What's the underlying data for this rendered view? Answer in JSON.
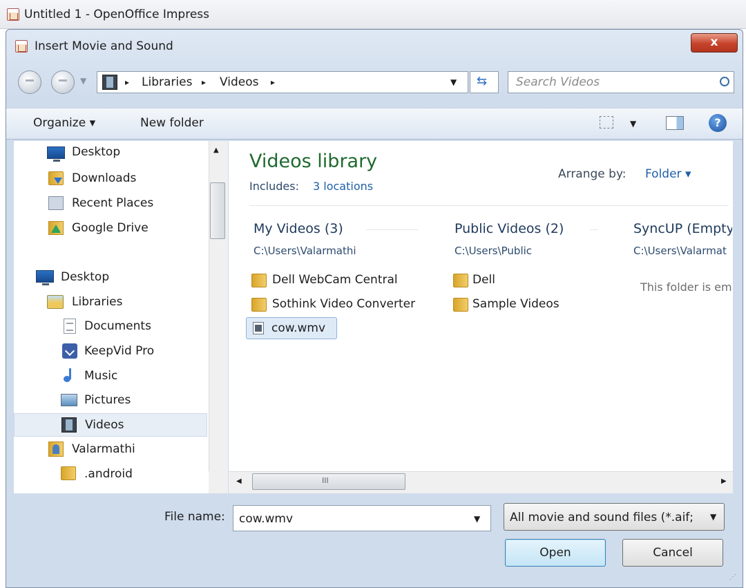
{
  "app": {
    "title": "Untitled 1 - OpenOffice Impress"
  },
  "dialog": {
    "title": "Insert Movie and Sound",
    "close": "x"
  },
  "address": {
    "crumbs": [
      "Libraries",
      "Videos"
    ],
    "separator": "▸"
  },
  "search": {
    "placeholder": "Search Videos"
  },
  "toolbar": {
    "organize": "Organize ▾",
    "new_folder": "New folder"
  },
  "nav": {
    "items": [
      {
        "label": "Desktop",
        "icon": "desktop-icon"
      },
      {
        "label": "Downloads",
        "icon": "downloads-icon"
      },
      {
        "label": "Recent Places",
        "icon": "recent-places-icon"
      },
      {
        "label": "Google Drive",
        "icon": "google-drive-icon"
      },
      {
        "label": "Desktop",
        "icon": "desktop-icon"
      },
      {
        "label": "Libraries",
        "icon": "libraries-icon"
      },
      {
        "label": "Documents",
        "icon": "documents-icon"
      },
      {
        "label": "KeepVid Pro",
        "icon": "keepvid-icon"
      },
      {
        "label": "Music",
        "icon": "music-icon"
      },
      {
        "label": "Pictures",
        "icon": "pictures-icon"
      },
      {
        "label": "Videos",
        "icon": "videos-icon",
        "selected": true
      },
      {
        "label": "Valarmathi",
        "icon": "user-folder-icon"
      },
      {
        "label": ".android",
        "icon": "folder-icon"
      }
    ]
  },
  "library": {
    "title": "Videos library",
    "includes_label": "Includes:",
    "includes_link": "3 locations",
    "arrange_label": "Arrange by:",
    "arrange_value": "Folder ▾"
  },
  "groups": [
    {
      "title": "My Videos (3)",
      "path": "C:\\Users\\Valarmathi",
      "items": [
        "Dell WebCam Central",
        "Sothink Video Converter",
        "cow.wmv"
      ]
    },
    {
      "title": "Public Videos (2)",
      "path": "C:\\Users\\Public",
      "items": [
        "Dell",
        "Sample Videos"
      ]
    },
    {
      "title": "SyncUP (Empty",
      "path": "C:\\Users\\Valarmat",
      "empty_text": "This folder is emp"
    }
  ],
  "hscroll": {
    "grip": "III"
  },
  "footer": {
    "file_name_label": "File name:",
    "file_name_value": "cow.wmv",
    "file_type": "All movie and sound files (*.aif;",
    "open": "Open",
    "cancel": "Cancel"
  }
}
